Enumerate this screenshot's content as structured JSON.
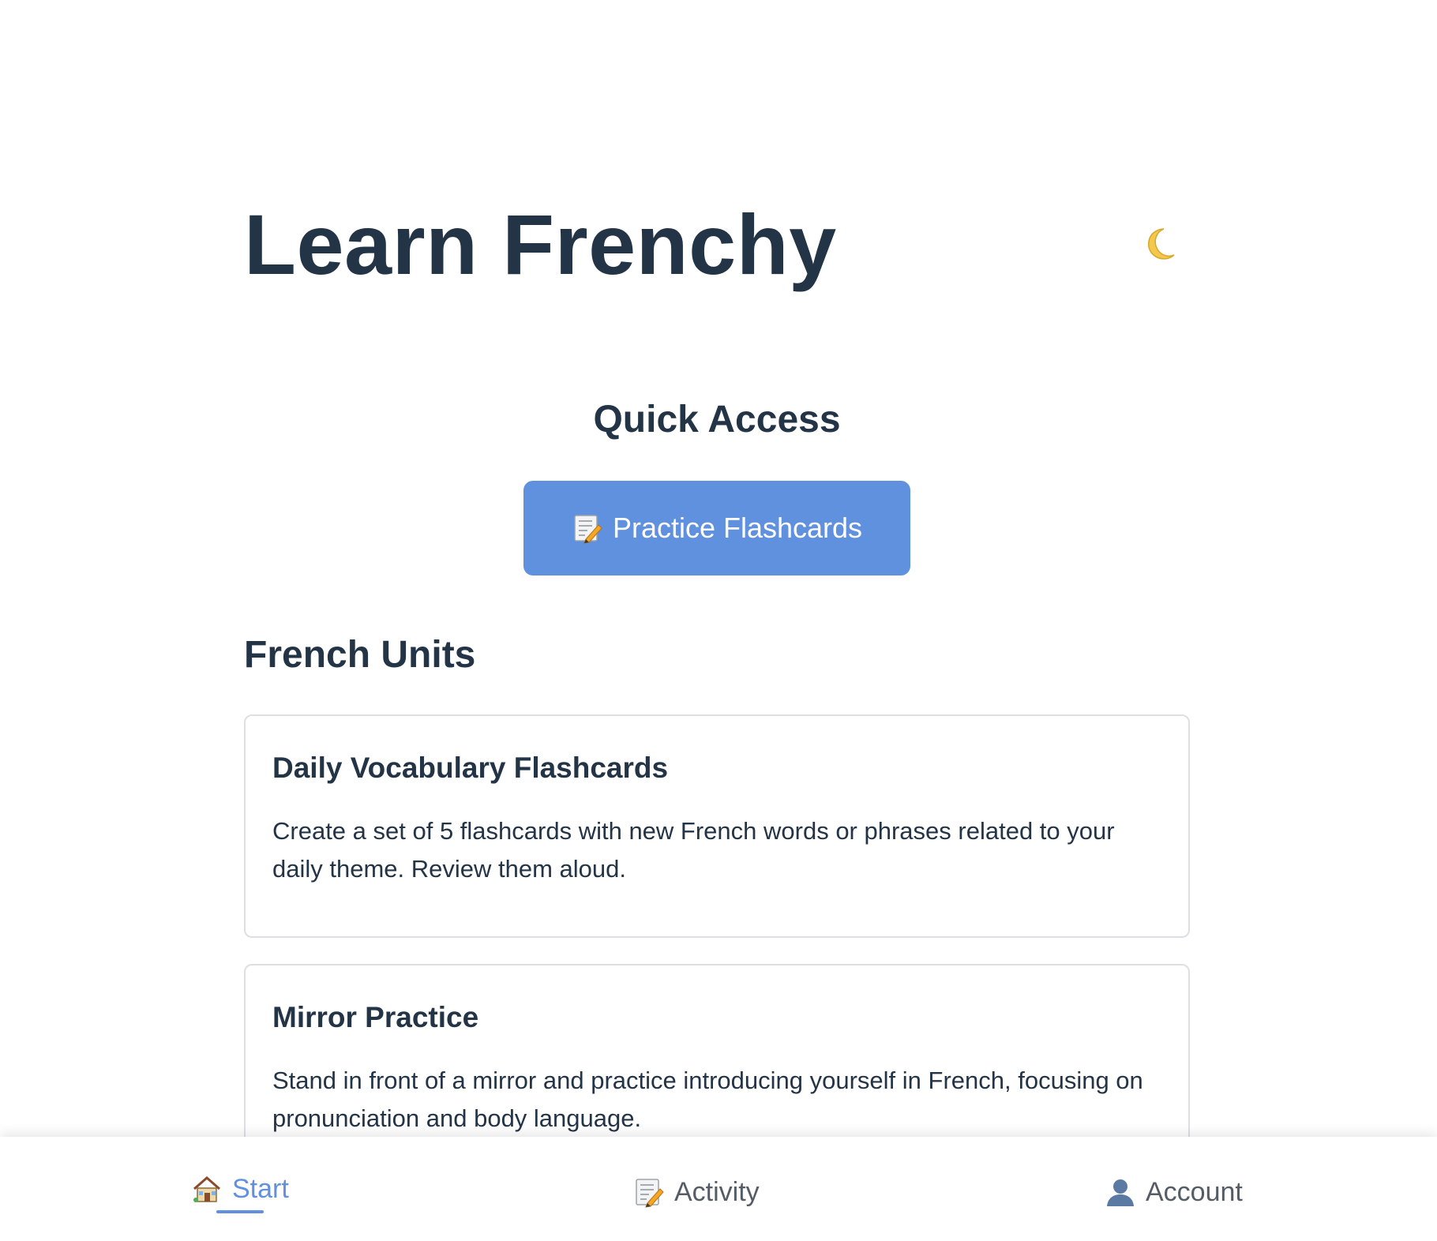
{
  "header": {
    "title": "Learn Frenchy",
    "theme_toggle_icon": "moon-icon"
  },
  "quick_access": {
    "title": "Quick Access",
    "button_label": "Practice Flashcards",
    "button_icon": "memo-pencil-icon"
  },
  "units": {
    "title": "French Units",
    "items": [
      {
        "title": "Daily Vocabulary Flashcards",
        "description": "Create a set of 5 flashcards with new French words or phrases related to your daily theme. Review them aloud."
      },
      {
        "title": "Mirror Practice",
        "description": "Stand in front of a mirror and practice introducing yourself in French, focusing on pronunciation and body language."
      }
    ]
  },
  "bottom_nav": {
    "items": [
      {
        "label": "Start",
        "icon": "house-icon",
        "active": true
      },
      {
        "label": "Activity",
        "icon": "memo-pencil-icon",
        "active": false
      },
      {
        "label": "Account",
        "icon": "user-icon",
        "active": false
      }
    ]
  },
  "colors": {
    "accent": "#5f91de",
    "text": "#243447",
    "muted": "#555c66",
    "moon": "#f2c94c"
  }
}
